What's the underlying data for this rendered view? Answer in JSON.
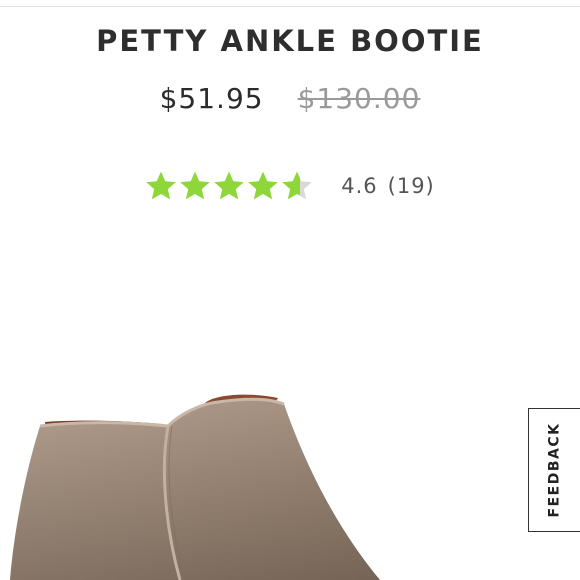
{
  "product": {
    "title": "PETTY ANKLE BOOTIE",
    "price_current": "$51.95",
    "price_original": "$130.00",
    "rating": {
      "value": 4.6,
      "value_text": "4.6",
      "count_text": "(19)",
      "max": 5
    },
    "image_icon": "suede-ankle-bootie-photo"
  },
  "feedback_tab": {
    "label": "FEEDBACK"
  },
  "colors": {
    "star": "#8fd63a",
    "star_empty": "#d9d9d9",
    "text": "#2b2b2b",
    "muted": "#9a9a9a",
    "suede": "#a89484"
  }
}
